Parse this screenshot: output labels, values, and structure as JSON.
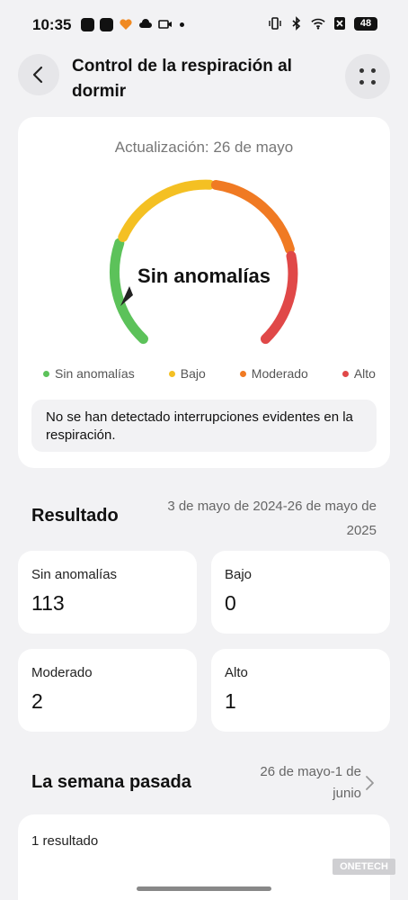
{
  "status_bar": {
    "time": "10:35",
    "battery": "48",
    "icons": [
      "notification-app-icon",
      "notification-app-icon",
      "heart-icon",
      "cloud-icon",
      "camera-icon",
      "vibrate-icon",
      "bluetooth-icon",
      "wifi-icon",
      "no-sim-icon",
      "battery-icon"
    ]
  },
  "header": {
    "title": "Control de la respiración al dormir",
    "back_icon": "chevron-left-icon",
    "menu_icon": "four-dots-icon"
  },
  "summary": {
    "update_label": "Actualización: 26 de mayo",
    "status": "Sin anomalías",
    "gauge_segments": [
      {
        "name": "Sin anomalías",
        "color": "#5cc25a"
      },
      {
        "name": "Bajo",
        "color": "#f4c023"
      },
      {
        "name": "Moderado",
        "color": "#f07a23"
      },
      {
        "name": "Alto",
        "color": "#e04848"
      }
    ],
    "message": "No se han detectado interrupciones evidentes en la respiración."
  },
  "result": {
    "heading": "Resultado",
    "range_line1": "3 de mayo de 2024-26 de mayo de",
    "range_line2": "2025",
    "stats": [
      {
        "label": "Sin anomalías",
        "value": "113"
      },
      {
        "label": "Bajo",
        "value": "0"
      },
      {
        "label": "Moderado",
        "value": "2"
      },
      {
        "label": "Alto",
        "value": "1"
      }
    ]
  },
  "last_week": {
    "heading": "La semana pasada",
    "range_line1": "26 de mayo-1 de",
    "range_line2": "junio",
    "result_count": "1 resultado"
  },
  "watermark": "ONETECH"
}
